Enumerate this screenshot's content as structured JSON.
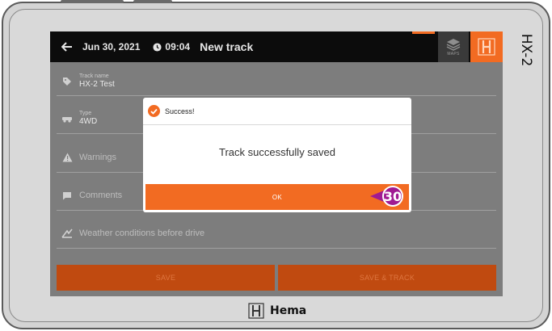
{
  "device": {
    "model_label": "HX-2",
    "brand": "Hema"
  },
  "appbar": {
    "date": "Jun 30, 2021",
    "time": "09:04",
    "title": "New track",
    "maps_label": "MAPS"
  },
  "fields": {
    "track_name_label": "Track name",
    "track_name_value": "HX-2 Test",
    "type_label": "Type",
    "type_value": "4WD",
    "warnings_label": "Warnings",
    "comments_label": "Comments",
    "weather_label": "Weather conditions before drive"
  },
  "buttons": {
    "save": "SAVE",
    "save_track": "SAVE & TRACK"
  },
  "dialog": {
    "title": "Success!",
    "message": "Track successfully saved",
    "ok": "OK"
  },
  "callout": {
    "number": "30"
  },
  "colors": {
    "accent": "#f26b22",
    "callout": "#a01a92",
    "appbar": "#0c0c0c"
  }
}
